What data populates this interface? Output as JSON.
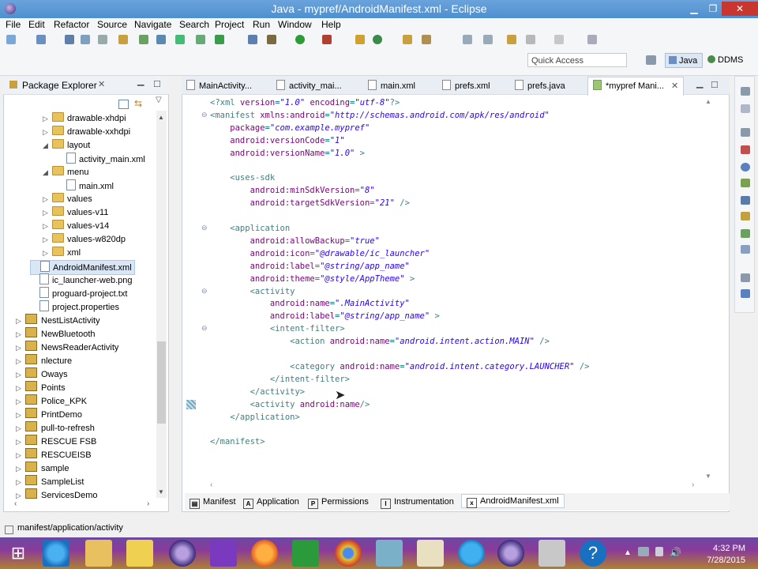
{
  "window": {
    "title": "Java - mypref/AndroidManifest.xml - Eclipse"
  },
  "menu": [
    "File",
    "Edit",
    "Refactor",
    "Source",
    "Navigate",
    "Search",
    "Project",
    "Run",
    "Window",
    "Help"
  ],
  "toolbar": {
    "quick_access_placeholder": "Quick Access",
    "perspectives": [
      "Java",
      "DDMS"
    ]
  },
  "package_explorer": {
    "title": "Package Explorer",
    "items": [
      {
        "label": "drawable-xhdpi",
        "depth": 2,
        "kind": "folder",
        "twisty": "▷"
      },
      {
        "label": "drawable-xxhdpi",
        "depth": 2,
        "kind": "folder",
        "twisty": "▷"
      },
      {
        "label": "layout",
        "depth": 2,
        "kind": "folder",
        "twisty": "◢"
      },
      {
        "label": "activity_main.xml",
        "depth": 3,
        "kind": "file",
        "twisty": ""
      },
      {
        "label": "menu",
        "depth": 2,
        "kind": "folder",
        "twisty": "◢"
      },
      {
        "label": "main.xml",
        "depth": 3,
        "kind": "file",
        "twisty": ""
      },
      {
        "label": "values",
        "depth": 2,
        "kind": "folder",
        "twisty": "▷"
      },
      {
        "label": "values-v11",
        "depth": 2,
        "kind": "folder",
        "twisty": "▷"
      },
      {
        "label": "values-v14",
        "depth": 2,
        "kind": "folder",
        "twisty": "▷"
      },
      {
        "label": "values-w820dp",
        "depth": 2,
        "kind": "folder",
        "twisty": "▷"
      },
      {
        "label": "xml",
        "depth": 2,
        "kind": "folder",
        "twisty": "▷"
      },
      {
        "label": "AndroidManifest.xml",
        "depth": 1,
        "kind": "file",
        "twisty": "",
        "selected": true
      },
      {
        "label": "ic_launcher-web.png",
        "depth": 1,
        "kind": "file",
        "twisty": ""
      },
      {
        "label": "proguard-project.txt",
        "depth": 1,
        "kind": "file",
        "twisty": ""
      },
      {
        "label": "project.properties",
        "depth": 1,
        "kind": "file",
        "twisty": ""
      },
      {
        "label": "NestListActivity",
        "depth": 0,
        "kind": "project",
        "twisty": "▷"
      },
      {
        "label": "NewBluetooth",
        "depth": 0,
        "kind": "project",
        "twisty": "▷"
      },
      {
        "label": "NewsReaderActivity",
        "depth": 0,
        "kind": "project",
        "twisty": "▷"
      },
      {
        "label": "nlecture",
        "depth": 0,
        "kind": "project",
        "twisty": "▷"
      },
      {
        "label": "Oways",
        "depth": 0,
        "kind": "project",
        "twisty": "▷"
      },
      {
        "label": "Points",
        "depth": 0,
        "kind": "project",
        "twisty": "▷"
      },
      {
        "label": "Police_KPK",
        "depth": 0,
        "kind": "project",
        "twisty": "▷"
      },
      {
        "label": "PrintDemo",
        "depth": 0,
        "kind": "project",
        "twisty": "▷"
      },
      {
        "label": "pull-to-refresh",
        "depth": 0,
        "kind": "project",
        "twisty": "▷"
      },
      {
        "label": "RESCUE FSB",
        "depth": 0,
        "kind": "project",
        "twisty": "▷"
      },
      {
        "label": "RESCUEISB",
        "depth": 0,
        "kind": "project",
        "twisty": "▷"
      },
      {
        "label": "sample",
        "depth": 0,
        "kind": "project",
        "twisty": "▷"
      },
      {
        "label": "SampleList",
        "depth": 0,
        "kind": "project",
        "twisty": "▷"
      },
      {
        "label": "ServicesDemo",
        "depth": 0,
        "kind": "project",
        "twisty": "▷"
      }
    ]
  },
  "editor_tabs": [
    "MainActivity...",
    "activity_mai...",
    "main.xml",
    "prefs.xml",
    "prefs.java",
    "*mypref Mani..."
  ],
  "code_lines": [
    [
      [
        "tg",
        "<?xml "
      ],
      [
        "at",
        "version"
      ],
      [
        "pu",
        "="
      ],
      [
        "vl",
        "\"1.0\""
      ],
      [
        "at",
        " encoding"
      ],
      [
        "pu",
        "="
      ],
      [
        "vl",
        "\"utf-8\""
      ],
      [
        "tg",
        "?>"
      ]
    ],
    [
      [
        "tg",
        "<manifest "
      ],
      [
        "at",
        "xmlns:android"
      ],
      [
        "pu",
        "="
      ],
      [
        "vl",
        "\"http://schemas.android.com/apk/res/android\""
      ]
    ],
    [
      [
        "at",
        "    package"
      ],
      [
        "pu",
        "="
      ],
      [
        "vl",
        "\"com.example.mypref\""
      ]
    ],
    [
      [
        "at",
        "    android:versionCode"
      ],
      [
        "pu",
        "="
      ],
      [
        "vl",
        "\"1\""
      ]
    ],
    [
      [
        "at",
        "    android:versionName"
      ],
      [
        "pu",
        "="
      ],
      [
        "vl",
        "\"1.0\""
      ],
      [
        "tg",
        " >"
      ]
    ],
    [
      [
        "tg",
        ""
      ]
    ],
    [
      [
        "tg",
        "    <uses-sdk"
      ]
    ],
    [
      [
        "at",
        "        android:minSdkVersion"
      ],
      [
        "pu",
        "="
      ],
      [
        "vl",
        "\"8\""
      ]
    ],
    [
      [
        "at",
        "        android:targetSdkVersion"
      ],
      [
        "pu",
        "="
      ],
      [
        "vl",
        "\"21\""
      ],
      [
        "tg",
        " />"
      ]
    ],
    [
      [
        "tg",
        ""
      ]
    ],
    [
      [
        "tg",
        "    <application"
      ]
    ],
    [
      [
        "at",
        "        android:allowBackup"
      ],
      [
        "pu",
        "="
      ],
      [
        "vl",
        "\"true\""
      ]
    ],
    [
      [
        "at",
        "        android:icon"
      ],
      [
        "pu",
        "="
      ],
      [
        "vl",
        "\"@drawable/ic_launcher\""
      ]
    ],
    [
      [
        "at",
        "        android:label"
      ],
      [
        "pu",
        "="
      ],
      [
        "vl",
        "\"@string/app_name\""
      ]
    ],
    [
      [
        "at",
        "        android:theme"
      ],
      [
        "pu",
        "="
      ],
      [
        "vl",
        "\"@style/AppTheme\""
      ],
      [
        "tg",
        " >"
      ]
    ],
    [
      [
        "tg",
        "        <activity"
      ]
    ],
    [
      [
        "at",
        "            android:name"
      ],
      [
        "pu",
        "="
      ],
      [
        "vl",
        "\".MainActivity\""
      ]
    ],
    [
      [
        "at",
        "            android:label"
      ],
      [
        "pu",
        "="
      ],
      [
        "vl",
        "\"@string/app_name\""
      ],
      [
        "tg",
        " >"
      ]
    ],
    [
      [
        "tg",
        "            <intent-filter>"
      ]
    ],
    [
      [
        "tg",
        "                <action "
      ],
      [
        "at",
        "android:name"
      ],
      [
        "pu",
        "="
      ],
      [
        "vl",
        "\"android.intent.action.MAIN\""
      ],
      [
        "tg",
        " />"
      ]
    ],
    [
      [
        "tg",
        ""
      ]
    ],
    [
      [
        "tg",
        "                <category "
      ],
      [
        "at",
        "android:name"
      ],
      [
        "pu",
        "="
      ],
      [
        "vl",
        "\"android.intent.category.LAUNCHER\""
      ],
      [
        "tg",
        " />"
      ]
    ],
    [
      [
        "tg",
        "            </intent-filter>"
      ]
    ],
    [
      [
        "tg",
        "        </activity>"
      ]
    ],
    [
      [
        "tg",
        "        <activity "
      ],
      [
        "at",
        "android:name"
      ],
      [
        "tg",
        "/>"
      ]
    ],
    [
      [
        "tg",
        "    </application>"
      ]
    ],
    [
      [
        "tg",
        ""
      ]
    ],
    [
      [
        "tg",
        "</manifest>"
      ]
    ]
  ],
  "bottom_tabs": [
    "Manifest",
    "Application",
    "Permissions",
    "Instrumentation",
    "AndroidManifest.xml"
  ],
  "status_bar": "manifest/application/activity",
  "clock": {
    "time": "4:32 PM",
    "date": "7/28/2015"
  }
}
